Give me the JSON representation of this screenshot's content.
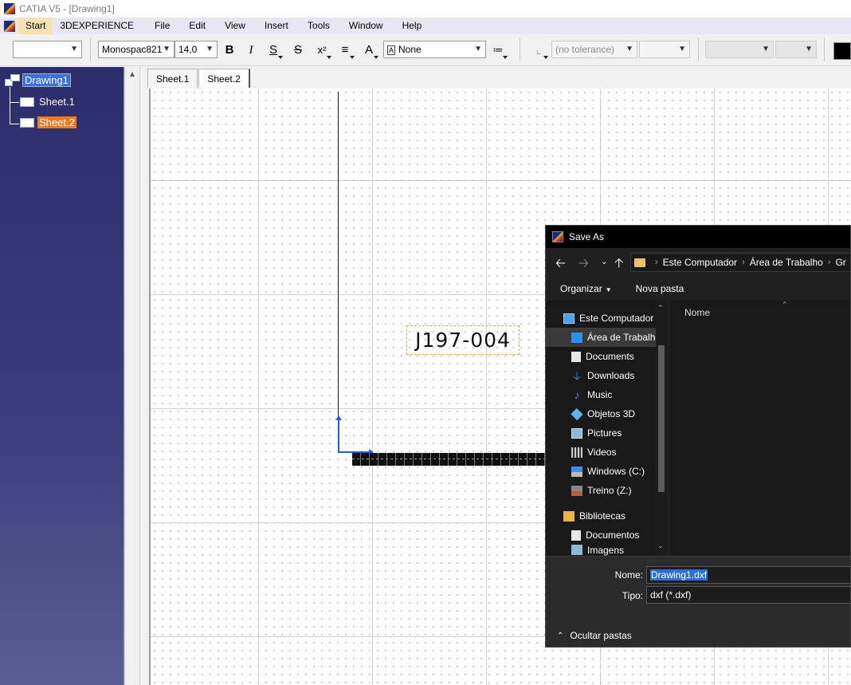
{
  "window": {
    "title": "CATIA V5 - [Drawing1]"
  },
  "menu": [
    "Start",
    "3DEXPERIENCE",
    "File",
    "Edit",
    "View",
    "Insert",
    "Tools",
    "Window",
    "Help"
  ],
  "toolbar": {
    "style_combo": "",
    "font_name": "Monospac821",
    "font_size": "14,0",
    "bold": "B",
    "italic": "I",
    "underline": "S",
    "strike": "S",
    "superscript": "x²",
    "frame_combo": "None",
    "tolerance_combo": "(no tolerance)"
  },
  "tree": {
    "root": "Drawing1",
    "children": [
      "Sheet.1",
      "Sheet.2"
    ]
  },
  "tabs": [
    "Sheet.1",
    "Sheet.2"
  ],
  "canvas": {
    "text": "J197-004"
  },
  "dialog": {
    "title": "Save As",
    "address": [
      "Este Computador",
      "Área de Trabalho",
      "Gr"
    ],
    "organize": "Organizar",
    "new_folder": "Nova pasta",
    "column_name": "Nome",
    "nav_items": [
      {
        "label": "Este Computador",
        "icon": "computer-icon"
      },
      {
        "label": "Área de Trabalho",
        "icon": "desktop-icon"
      },
      {
        "label": "Documents",
        "icon": "documents-icon"
      },
      {
        "label": "Downloads",
        "icon": "downloads-icon"
      },
      {
        "label": "Music",
        "icon": "music-icon"
      },
      {
        "label": "Objetos 3D",
        "icon": "objects-3d-icon"
      },
      {
        "label": "Pictures",
        "icon": "pictures-icon"
      },
      {
        "label": "Videos",
        "icon": "videos-icon"
      },
      {
        "label": "Windows (C:)",
        "icon": "drive-c-icon"
      },
      {
        "label": "Treino (Z:)",
        "icon": "network-drive-icon"
      },
      {
        "label": "Bibliotecas",
        "icon": "libraries-icon"
      },
      {
        "label": "Documentos",
        "icon": "documents-library-icon"
      },
      {
        "label": "Imagens",
        "icon": "images-library-icon"
      }
    ],
    "name_label": "Nome:",
    "name_value": "Drawing1.dxf",
    "type_label": "Tipo:",
    "type_value": "dxf (*.dxf)",
    "hide_folders": "Ocultar pastas"
  },
  "colors": {
    "tree_bg": "#2d2d6c",
    "sheet_selected": "#f07a22",
    "axis_blue": "#1f5fd8",
    "dialog_bg": "#202020",
    "selection_blue": "#2f6ed6"
  }
}
